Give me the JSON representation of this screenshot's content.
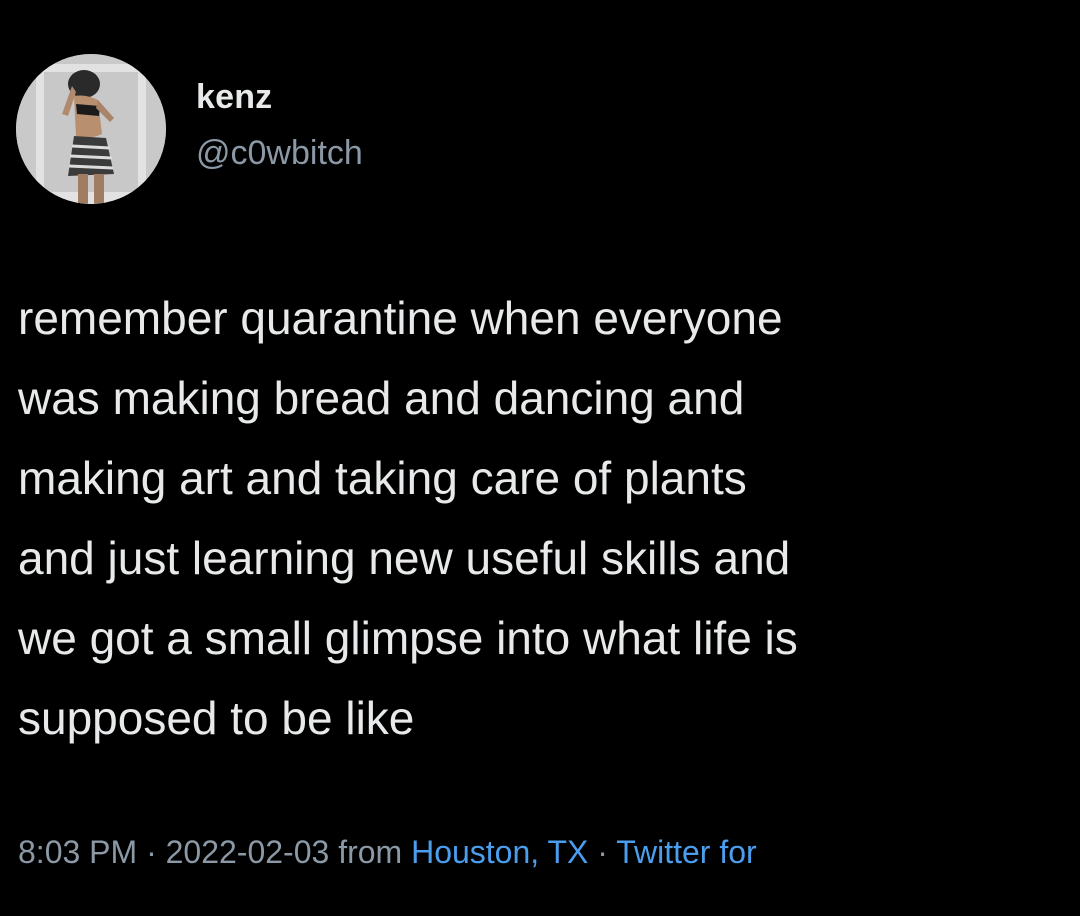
{
  "user": {
    "display_name": "kenz",
    "handle": "@c0wbitch",
    "avatar_icon": "profile-photo-avatar"
  },
  "tweet": {
    "text": "remember quarantine when everyone\nwas making bread and dancing and\nmaking art and taking care of plants\nand just learning new useful skills and\nwe got a small glimpse into what life is\nsupposed to be like"
  },
  "meta": {
    "time": "8:03 PM",
    "separator_1": " · ",
    "date": "2022-02-03",
    "from_label": " from ",
    "location": "Houston, TX",
    "separator_2": " · ",
    "source": "Twitter for"
  },
  "colors": {
    "background": "#000000",
    "primary_text": "#e7e9ea",
    "secondary_text": "#8b98a5",
    "link": "#4a9eed"
  }
}
